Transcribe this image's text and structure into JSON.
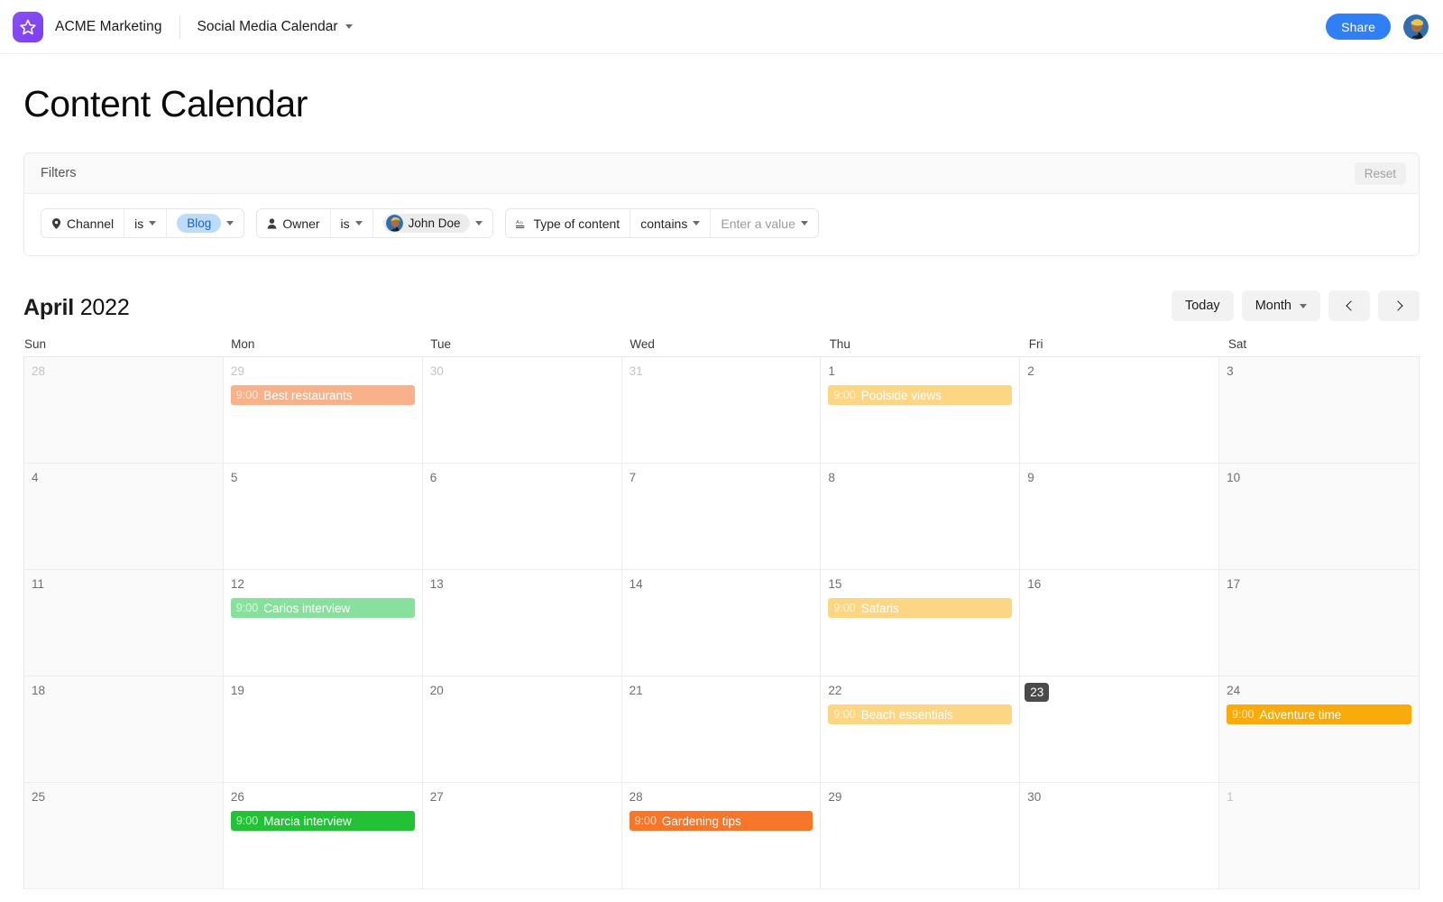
{
  "topbar": {
    "brand_name": "ACME Marketing",
    "doc_title": "Social Media Calendar",
    "share_label": "Share",
    "logo_icon": "star-icon",
    "doc_caret_icon": "chevron-down-icon",
    "avatar_icon": "user-avatar"
  },
  "page": {
    "title": "Content Calendar"
  },
  "filters": {
    "label": "Filters",
    "reset_label": "Reset",
    "rows": [
      {
        "field": "Channel",
        "field_icon": "location-pin-icon",
        "operator": "is",
        "value": "Blog",
        "value_style": "chip-blue"
      },
      {
        "field": "Owner",
        "field_icon": "person-icon",
        "operator": "is",
        "value": "John Doe",
        "value_style": "chip-avatar"
      },
      {
        "field": "Type of content",
        "field_icon": "text-format-icon",
        "operator": "contains",
        "value": "Enter a value",
        "value_style": "placeholder"
      }
    ]
  },
  "calendar": {
    "month": "April",
    "year": "2022",
    "today_label": "Today",
    "view_label": "Month",
    "prev_icon": "chevron-left-icon",
    "next_icon": "chevron-right-icon",
    "view_caret_icon": "chevron-down-icon",
    "dow": [
      "Sun",
      "Mon",
      "Tue",
      "Wed",
      "Thu",
      "Fri",
      "Sat"
    ],
    "colors": {
      "peach": "#f9b18a",
      "light_amber": "#fcd682",
      "light_green": "#87e09b",
      "amber": "#f9ab0b",
      "green": "#23c236",
      "orange": "#f7762a",
      "today_badge": "#4a4a4a"
    },
    "cells": [
      {
        "day": "28",
        "out": true,
        "weekend": true,
        "today": false,
        "events": []
      },
      {
        "day": "29",
        "out": true,
        "weekend": false,
        "today": false,
        "events": [
          {
            "time": "9:00",
            "name": "Best restaurants",
            "color": "#f9b18a"
          }
        ]
      },
      {
        "day": "30",
        "out": true,
        "weekend": false,
        "today": false,
        "events": []
      },
      {
        "day": "31",
        "out": true,
        "weekend": false,
        "today": false,
        "events": []
      },
      {
        "day": "1",
        "out": false,
        "weekend": false,
        "today": false,
        "events": [
          {
            "time": "9:00",
            "name": "Poolside views",
            "color": "#fcd682"
          }
        ]
      },
      {
        "day": "2",
        "out": false,
        "weekend": false,
        "today": false,
        "events": []
      },
      {
        "day": "3",
        "out": false,
        "weekend": true,
        "today": false,
        "events": []
      },
      {
        "day": "4",
        "out": false,
        "weekend": true,
        "today": false,
        "events": []
      },
      {
        "day": "5",
        "out": false,
        "weekend": false,
        "today": false,
        "events": []
      },
      {
        "day": "6",
        "out": false,
        "weekend": false,
        "today": false,
        "events": []
      },
      {
        "day": "7",
        "out": false,
        "weekend": false,
        "today": false,
        "events": []
      },
      {
        "day": "8",
        "out": false,
        "weekend": false,
        "today": false,
        "events": []
      },
      {
        "day": "9",
        "out": false,
        "weekend": false,
        "today": false,
        "events": []
      },
      {
        "day": "10",
        "out": false,
        "weekend": true,
        "today": false,
        "events": []
      },
      {
        "day": "11",
        "out": false,
        "weekend": true,
        "today": false,
        "events": []
      },
      {
        "day": "12",
        "out": false,
        "weekend": false,
        "today": false,
        "events": [
          {
            "time": "9:00",
            "name": "Carlos interview",
            "color": "#87e09b"
          }
        ]
      },
      {
        "day": "13",
        "out": false,
        "weekend": false,
        "today": false,
        "events": []
      },
      {
        "day": "14",
        "out": false,
        "weekend": false,
        "today": false,
        "events": []
      },
      {
        "day": "15",
        "out": false,
        "weekend": false,
        "today": false,
        "events": [
          {
            "time": "9:00",
            "name": "Safaris",
            "color": "#fcd682"
          }
        ]
      },
      {
        "day": "16",
        "out": false,
        "weekend": false,
        "today": false,
        "events": []
      },
      {
        "day": "17",
        "out": false,
        "weekend": true,
        "today": false,
        "events": []
      },
      {
        "day": "18",
        "out": false,
        "weekend": true,
        "today": false,
        "events": []
      },
      {
        "day": "19",
        "out": false,
        "weekend": false,
        "today": false,
        "events": []
      },
      {
        "day": "20",
        "out": false,
        "weekend": false,
        "today": false,
        "events": []
      },
      {
        "day": "21",
        "out": false,
        "weekend": false,
        "today": false,
        "events": []
      },
      {
        "day": "22",
        "out": false,
        "weekend": false,
        "today": false,
        "events": [
          {
            "time": "9:00",
            "name": "Beach essentials",
            "color": "#fcd682"
          }
        ]
      },
      {
        "day": "23",
        "out": false,
        "weekend": false,
        "today": true,
        "events": []
      },
      {
        "day": "24",
        "out": false,
        "weekend": true,
        "today": false,
        "events": [
          {
            "time": "9:00",
            "name": "Adventure time",
            "color": "#f9ab0b"
          }
        ]
      },
      {
        "day": "25",
        "out": false,
        "weekend": true,
        "today": false,
        "events": []
      },
      {
        "day": "26",
        "out": false,
        "weekend": false,
        "today": false,
        "events": [
          {
            "time": "9:00",
            "name": "Marcia interview",
            "color": "#23c236"
          }
        ]
      },
      {
        "day": "27",
        "out": false,
        "weekend": false,
        "today": false,
        "events": []
      },
      {
        "day": "28",
        "out": false,
        "weekend": false,
        "today": false,
        "events": [
          {
            "time": "9:00",
            "name": "Gardening tips",
            "color": "#f7762a"
          }
        ]
      },
      {
        "day": "29",
        "out": false,
        "weekend": false,
        "today": false,
        "events": []
      },
      {
        "day": "30",
        "out": false,
        "weekend": false,
        "today": false,
        "events": []
      },
      {
        "day": "1",
        "out": true,
        "weekend": true,
        "today": false,
        "events": []
      }
    ]
  }
}
